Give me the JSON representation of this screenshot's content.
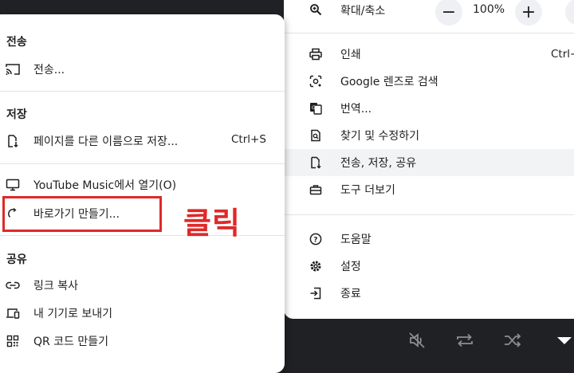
{
  "main_menu": {
    "zoom": {
      "label": "확대/축소",
      "minus": "−",
      "value": "100%",
      "plus": "+"
    },
    "items": [
      {
        "label": "인쇄",
        "shortcut": "Ctrl+"
      },
      {
        "label": "Google 렌즈로 검색"
      },
      {
        "label": "번역..."
      },
      {
        "label": "찾기 및 수정하기"
      },
      {
        "label": "전송, 저장, 공유"
      },
      {
        "label": "도구 더보기"
      },
      {
        "label": "도움말"
      },
      {
        "label": "설정"
      },
      {
        "label": "종료"
      }
    ]
  },
  "sub_menu": {
    "cast_header": "전송",
    "cast_item": "전송...",
    "save_header": "저장",
    "save_page": "페이지를 다른 이름으로 저장...",
    "save_page_shortcut": "Ctrl+S",
    "open_app": "YouTube Music에서 열기(O)",
    "create_shortcut": "바로가기 만들기...",
    "share_header": "공유",
    "copy_link": "링크 복사",
    "send_to_devices": "내 기기로 보내기",
    "qr_code": "QR 코드 만들기"
  },
  "annotation": {
    "text": "클릭",
    "color": "#e02828"
  },
  "colors": {
    "highlight": "#f1f3f4",
    "dark_bg": "#202124"
  }
}
